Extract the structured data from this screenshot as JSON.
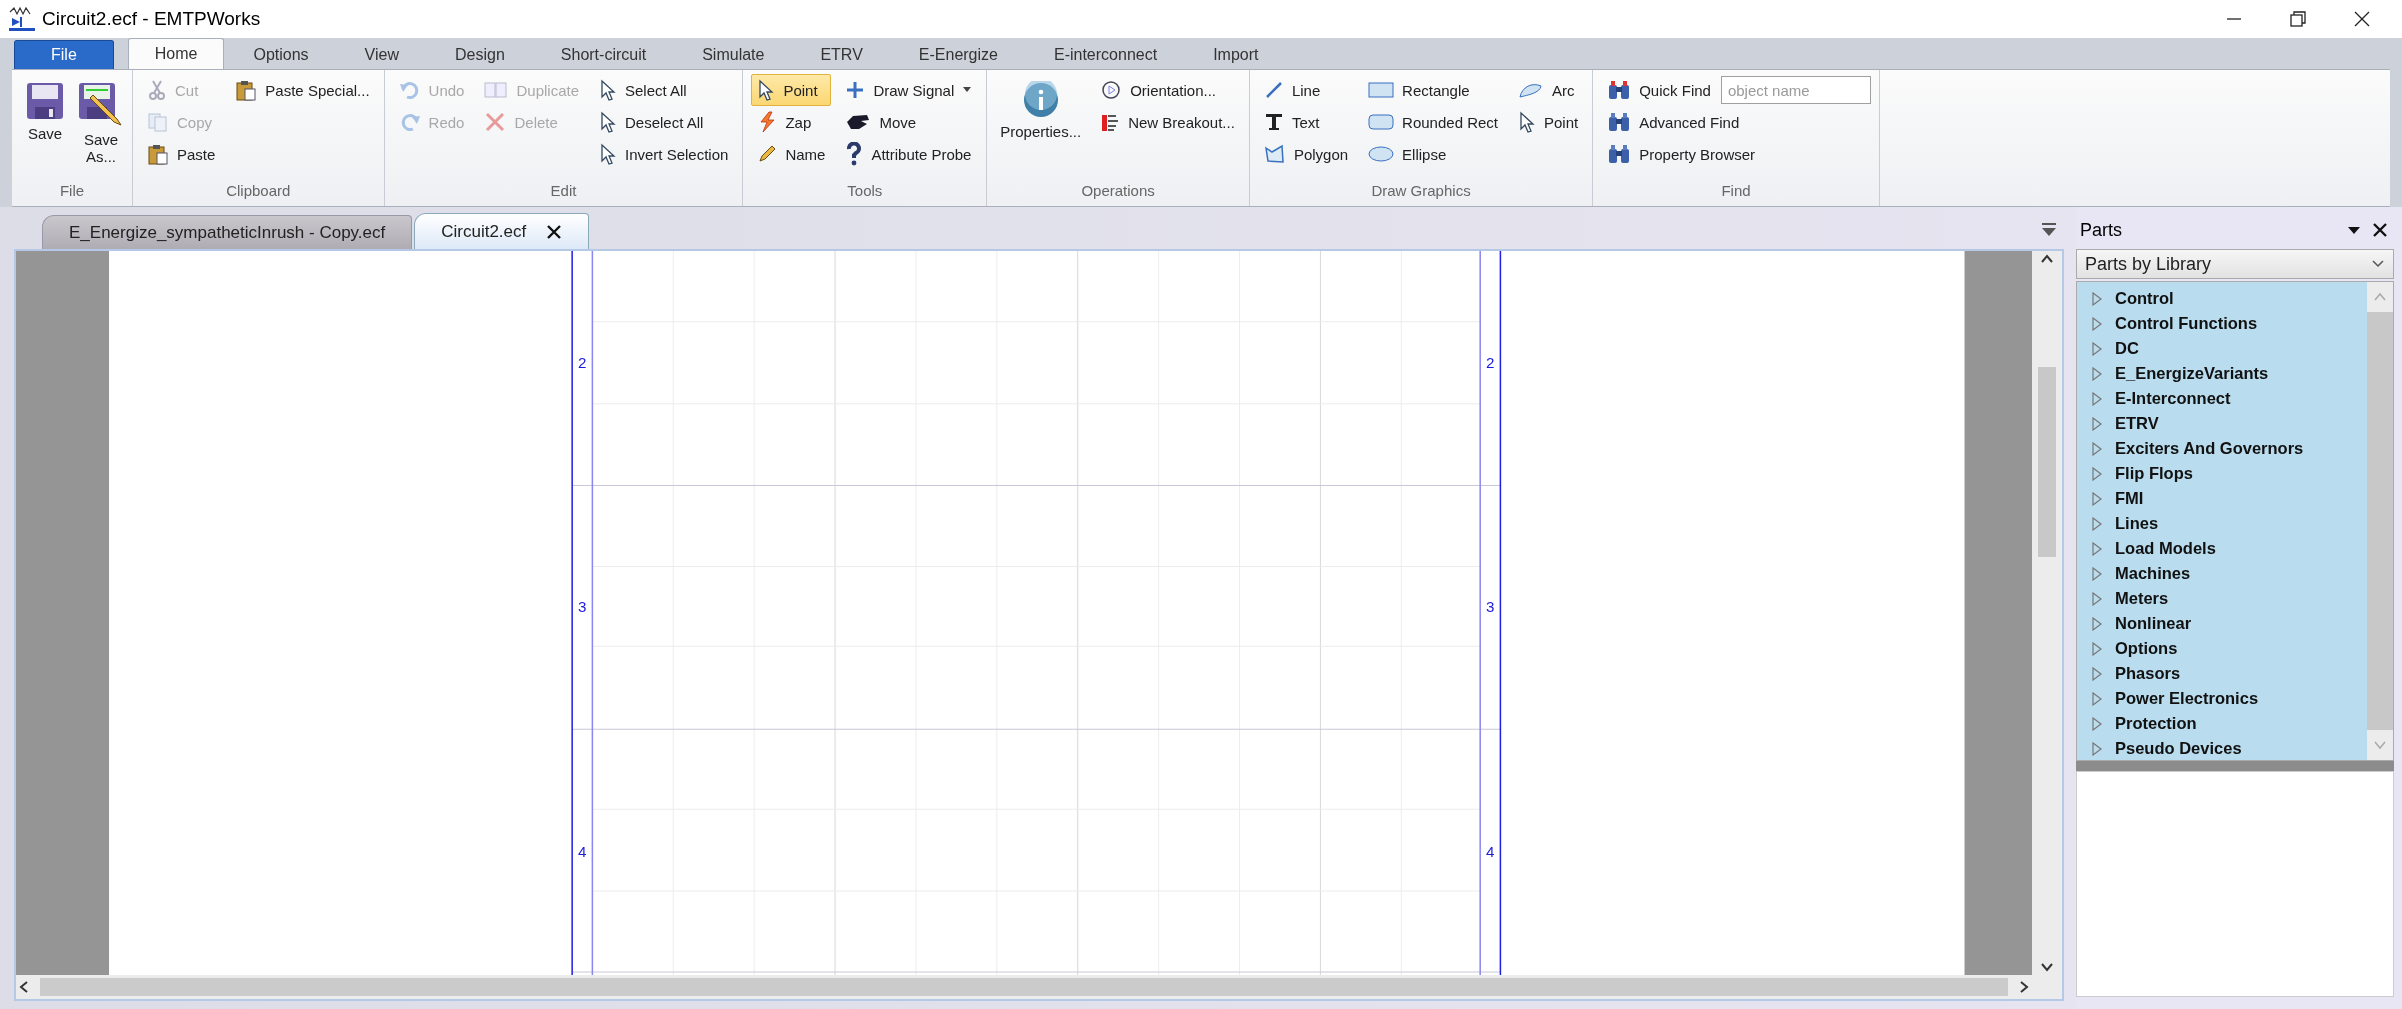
{
  "window": {
    "title": "Circuit2.ecf - EMTPWorks"
  },
  "ribbon_tabs": [
    {
      "label": "File",
      "kind": "file",
      "selected": false
    },
    {
      "label": "Home",
      "kind": "tab",
      "selected": true
    },
    {
      "label": "Options",
      "kind": "tab",
      "selected": false
    },
    {
      "label": "View",
      "kind": "tab",
      "selected": false
    },
    {
      "label": "Design",
      "kind": "tab",
      "selected": false
    },
    {
      "label": "Short-circuit",
      "kind": "tab",
      "selected": false
    },
    {
      "label": "Simulate",
      "kind": "tab",
      "selected": false
    },
    {
      "label": "ETRV",
      "kind": "tab",
      "selected": false
    },
    {
      "label": "E-Energize",
      "kind": "tab",
      "selected": false
    },
    {
      "label": "E-interconnect",
      "kind": "tab",
      "selected": false
    },
    {
      "label": "Import",
      "kind": "tab",
      "selected": false
    }
  ],
  "ribbon_groups": [
    {
      "label": "File",
      "columns": [
        [
          {
            "label": "Save",
            "kind": "large",
            "disabled": false,
            "selected": false
          }
        ],
        [
          {
            "label": "Save As...",
            "kind": "large",
            "disabled": false,
            "selected": false
          }
        ]
      ]
    },
    {
      "label": "Clipboard",
      "columns": [
        [
          {
            "label": "Cut",
            "kind": "small",
            "disabled": true,
            "selected": false
          },
          {
            "label": "Copy",
            "kind": "small",
            "disabled": true,
            "selected": false
          },
          {
            "label": "Paste",
            "kind": "small",
            "disabled": false,
            "selected": false
          }
        ],
        [
          {
            "label": "Paste Special...",
            "kind": "small",
            "disabled": false,
            "selected": false
          }
        ]
      ]
    },
    {
      "label": "Edit",
      "columns": [
        [
          {
            "label": "Undo",
            "kind": "small",
            "disabled": true,
            "selected": false
          },
          {
            "label": "Redo",
            "kind": "small",
            "disabled": true,
            "selected": false
          }
        ],
        [
          {
            "label": "Duplicate",
            "kind": "small",
            "disabled": true,
            "selected": false
          },
          {
            "label": "Delete",
            "kind": "small",
            "disabled": true,
            "selected": false
          }
        ],
        [
          {
            "label": "Select All",
            "kind": "small",
            "disabled": false,
            "selected": false
          },
          {
            "label": "Deselect All",
            "kind": "small",
            "disabled": false,
            "selected": false
          },
          {
            "label": "Invert Selection",
            "kind": "small",
            "disabled": false,
            "selected": false
          }
        ]
      ]
    },
    {
      "label": "Tools",
      "columns": [
        [
          {
            "label": "Point",
            "kind": "small",
            "disabled": false,
            "selected": true
          },
          {
            "label": "Zap",
            "kind": "small",
            "disabled": false,
            "selected": false
          },
          {
            "label": "Name",
            "kind": "small",
            "disabled": false,
            "selected": false
          }
        ],
        [
          {
            "label": "Draw Signal",
            "kind": "menu",
            "disabled": false,
            "selected": false
          },
          {
            "label": "Move",
            "kind": "small",
            "disabled": false,
            "selected": false
          },
          {
            "label": "Attribute Probe",
            "kind": "small",
            "disabled": false,
            "selected": false
          }
        ]
      ]
    },
    {
      "label": "Operations",
      "columns": [
        [
          {
            "label": "Properties...",
            "kind": "large",
            "disabled": false,
            "selected": false
          }
        ],
        [
          {
            "label": "Orientation...",
            "kind": "small",
            "disabled": false,
            "selected": false
          },
          {
            "label": "New Breakout...",
            "kind": "small",
            "disabled": false,
            "selected": false
          }
        ]
      ]
    },
    {
      "label": "Draw Graphics",
      "columns": [
        [
          {
            "label": "Line",
            "kind": "small",
            "disabled": false,
            "selected": false
          },
          {
            "label": "Text",
            "kind": "small",
            "disabled": false,
            "selected": false
          },
          {
            "label": "Polygon",
            "kind": "small",
            "disabled": false,
            "selected": false
          }
        ],
        [
          {
            "label": "Rectangle",
            "kind": "small",
            "disabled": false,
            "selected": false
          },
          {
            "label": "Rounded Rect",
            "kind": "small",
            "disabled": false,
            "selected": false
          },
          {
            "label": "Ellipse",
            "kind": "small",
            "disabled": false,
            "selected": false
          }
        ],
        [
          {
            "label": "Arc",
            "kind": "small",
            "disabled": false,
            "selected": false
          },
          {
            "label": "Point",
            "kind": "small",
            "disabled": false,
            "selected": false
          }
        ]
      ]
    },
    {
      "label": "Find",
      "columns": [
        [
          {
            "label": "Quick Find",
            "kind": "search",
            "placeholder": "object name",
            "disabled": false,
            "selected": false
          },
          {
            "label": "Advanced Find",
            "kind": "small",
            "disabled": false,
            "selected": false
          },
          {
            "label": "Property Browser",
            "kind": "small",
            "disabled": false,
            "selected": false
          }
        ]
      ]
    }
  ],
  "document_tabs": [
    {
      "label": "E_Energize_sympatheticInrush - Copy.ecf",
      "selected": false
    },
    {
      "label": "Circuit2.ecf",
      "selected": true
    }
  ],
  "canvas": {
    "left_row_labels": [
      "2",
      "3",
      "4"
    ],
    "right_row_labels": [
      "2",
      "3",
      "4"
    ]
  },
  "parts_panel": {
    "title": "Parts",
    "view": "Parts by Library",
    "items": [
      {
        "label": "Control",
        "expanded": false
      },
      {
        "label": "Control Functions",
        "expanded": false
      },
      {
        "label": "DC",
        "expanded": false
      },
      {
        "label": "E_EnergizeVariants",
        "expanded": false
      },
      {
        "label": "E-Interconnect",
        "expanded": false
      },
      {
        "label": "ETRV",
        "expanded": false
      },
      {
        "label": "Exciters And Governors",
        "expanded": false
      },
      {
        "label": "Flip Flops",
        "expanded": false
      },
      {
        "label": "FMI",
        "expanded": false
      },
      {
        "label": "Lines",
        "expanded": false
      },
      {
        "label": "Load Models",
        "expanded": false
      },
      {
        "label": "Machines",
        "expanded": false
      },
      {
        "label": "Meters",
        "expanded": false
      },
      {
        "label": "Nonlinear",
        "expanded": false
      },
      {
        "label": "Options",
        "expanded": false
      },
      {
        "label": "Phasors",
        "expanded": false
      },
      {
        "label": "Power Electronics",
        "expanded": false
      },
      {
        "label": "Protection",
        "expanded": false
      },
      {
        "label": "Pseudo Devices",
        "expanded": false
      }
    ]
  }
}
